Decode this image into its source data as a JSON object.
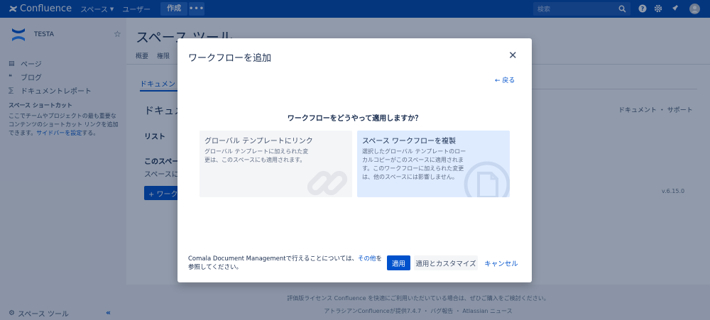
{
  "topnav": {
    "brand": "Confluence",
    "spaces": "スペース",
    "users": "ユーザー",
    "create": "作成",
    "more": "•••",
    "search_placeholder": "検索",
    "icons": [
      "search-icon",
      "help-icon",
      "gear-icon",
      "notifications-icon",
      "avatar"
    ]
  },
  "sidebar": {
    "space_name": "TESTA",
    "items": [
      {
        "label": "ページ",
        "icon": "page-icon"
      },
      {
        "label": "ブログ",
        "icon": "blog-icon"
      },
      {
        "label": "ドキュメントレポート",
        "icon": "report-icon"
      }
    ],
    "shortcut_title": "スペース ショートカット",
    "shortcut_desc_pre": "ここでチームやプロジェクトの最も重要なコンテンツのショートカット リンクを追加できます。",
    "shortcut_link": "サイドバーを設定",
    "shortcut_desc_post": "する。",
    "space_tools": "スペース ツール",
    "collapse": "«"
  },
  "main": {
    "title": "スペース ツール",
    "tabs": [
      "概要",
      "権限"
    ],
    "subtab": "ドキュメント",
    "doc_heading": "ドキュメ",
    "doc_links": "ドキュメント ・ サポート",
    "list_label": "リスト",
    "this_space": "このスペー",
    "space_desc": "スペースに",
    "add_button": "+ ワーク",
    "version": "v.6.15.0",
    "footer1": "評価版ライセンス Confluence を快適にご利用いただいている場合は、ぜひご購入をご検討ください。",
    "footer2": "アトラシアンConfluenceが提供7.4.7 ・ バグ報告 ・ Atlassian ニュース"
  },
  "modal": {
    "title": "ワークフローを追加",
    "close": "✕",
    "back": "← 戻る",
    "question": "ワークフローをどうやって適用しますか？",
    "options": [
      {
        "title": "グローバル テンプレートにリンク",
        "desc": "グローバル テンプレートに加えられた変更は、このスペースにも適用されます。",
        "icon": "link-icon"
      },
      {
        "title": "スペース ワークフローを複製",
        "desc": "選択したグローバル テンプレートのローカルコピーがこのスペースに適用されます。このワークフローに加えられた変更は、他のスペースには影響しません。",
        "icon": "copy-document-icon"
      }
    ],
    "footer_text_pre": "Comala Document Managementで行えることについては、",
    "footer_link": "その他",
    "footer_text_post": "を参照してください。",
    "apply": "適用",
    "apply_customize": "適用とカスタマイズ",
    "cancel": "キャンセル"
  }
}
